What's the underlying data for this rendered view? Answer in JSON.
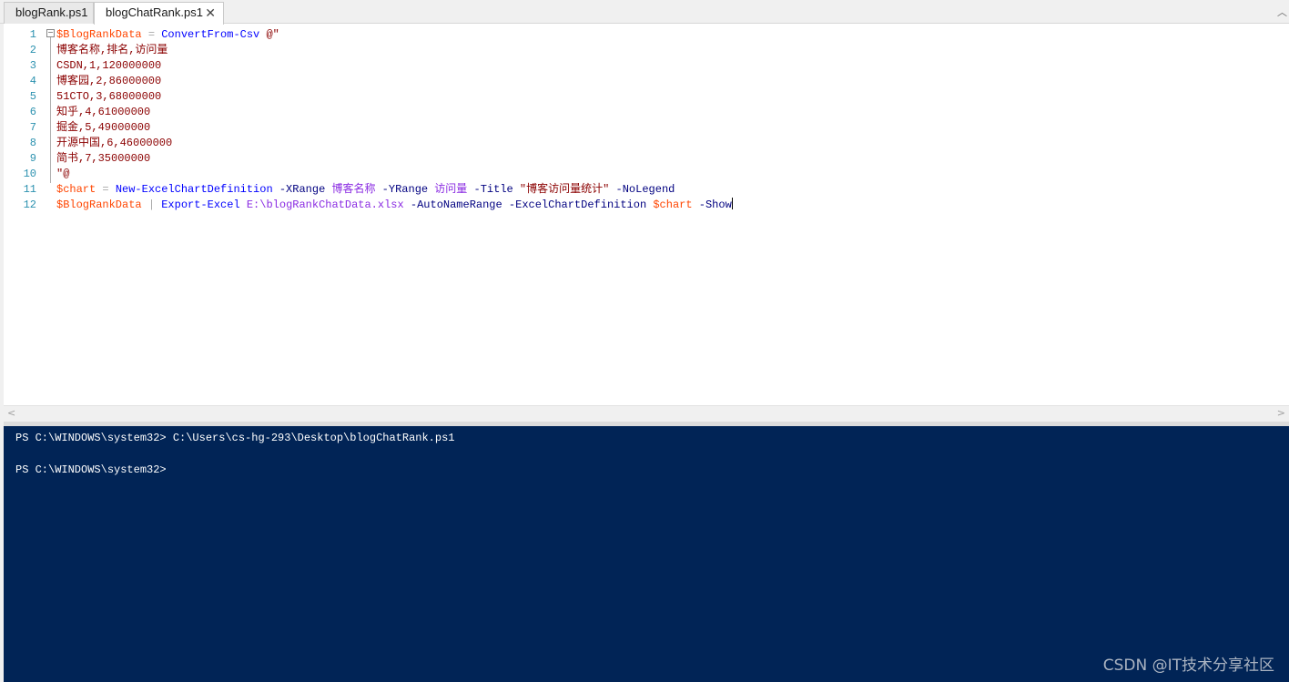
{
  "tabs": [
    {
      "label": "blogRank.ps1",
      "active": false
    },
    {
      "label": "blogChatRank.ps1",
      "active": true,
      "close": "✕"
    }
  ],
  "editor": {
    "line_numbers": [
      "1",
      "2",
      "3",
      "4",
      "5",
      "6",
      "7",
      "8",
      "9",
      "10",
      "11",
      "12"
    ],
    "fold_marker": "−",
    "lines": [
      {
        "tokens": [
          {
            "t": "$BlogRankData",
            "c": "tv"
          },
          {
            "t": " = ",
            "c": "to"
          },
          {
            "t": "ConvertFrom-Csv",
            "c": "tc"
          },
          {
            "t": " @\"",
            "c": "ts"
          }
        ]
      },
      {
        "tokens": [
          {
            "t": "博客名称,排名,访问量",
            "c": "ts"
          }
        ]
      },
      {
        "tokens": [
          {
            "t": "CSDN,1,120000000",
            "c": "ts"
          }
        ]
      },
      {
        "tokens": [
          {
            "t": "博客园,2,86000000",
            "c": "ts"
          }
        ]
      },
      {
        "tokens": [
          {
            "t": "51CTO,3,68000000",
            "c": "ts"
          }
        ]
      },
      {
        "tokens": [
          {
            "t": "知乎,4,61000000",
            "c": "ts"
          }
        ]
      },
      {
        "tokens": [
          {
            "t": "掘金,5,49000000",
            "c": "ts"
          }
        ]
      },
      {
        "tokens": [
          {
            "t": "开源中国,6,46000000",
            "c": "ts"
          }
        ]
      },
      {
        "tokens": [
          {
            "t": "简书,7,35000000",
            "c": "ts"
          }
        ]
      },
      {
        "tokens": [
          {
            "t": "\"@",
            "c": "ts"
          }
        ]
      },
      {
        "tokens": [
          {
            "t": "$chart",
            "c": "tv"
          },
          {
            "t": " = ",
            "c": "to"
          },
          {
            "t": "New-ExcelChartDefinition",
            "c": "tc"
          },
          {
            "t": " -XRange ",
            "c": "tp"
          },
          {
            "t": "博客名称",
            "c": "tw"
          },
          {
            "t": " -YRange ",
            "c": "tp"
          },
          {
            "t": "访问量",
            "c": "tw"
          },
          {
            "t": " -Title ",
            "c": "tp"
          },
          {
            "t": "\"博客访问量统计\"",
            "c": "ts"
          },
          {
            "t": " -NoLegend",
            "c": "tp"
          }
        ]
      },
      {
        "tokens": [
          {
            "t": "$BlogRankData",
            "c": "tv"
          },
          {
            "t": " | ",
            "c": "to"
          },
          {
            "t": "Export-Excel",
            "c": "tc"
          },
          {
            "t": " E:\\blogRankChatData.xlsx",
            "c": "tw"
          },
          {
            "t": " -AutoNameRange",
            "c": "tp"
          },
          {
            "t": " -ExcelChartDefinition ",
            "c": "tp"
          },
          {
            "t": "$chart",
            "c": "tv"
          },
          {
            "t": " -Show",
            "c": "tp"
          }
        ]
      }
    ]
  },
  "scrollbar": {
    "left_arrow": "<",
    "right_arrow": ">"
  },
  "console": {
    "lines": [
      "PS C:\\WINDOWS\\system32> C:\\Users\\cs-hg-293\\Desktop\\blogChatRank.ps1",
      "",
      "PS C:\\WINDOWS\\system32>"
    ]
  },
  "watermark": "CSDN @IT技术分享社区",
  "colors": {
    "console_bg": "#012456",
    "variable": "#ff4500",
    "command": "#0000ff",
    "parameter": "#000080",
    "string": "#8b0000",
    "argument": "#8a2be2",
    "operator": "#a9a9a9",
    "line_number": "#2b91af"
  }
}
